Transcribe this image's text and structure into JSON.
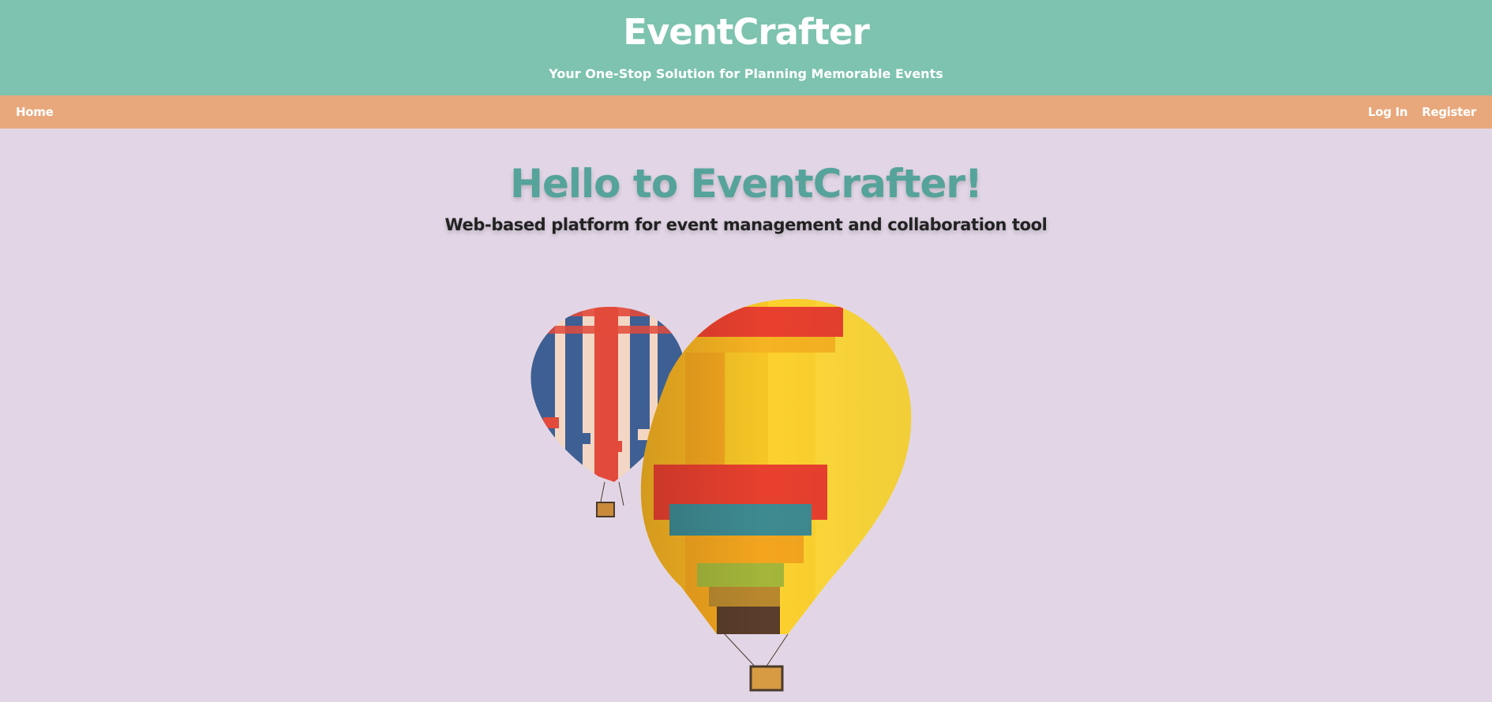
{
  "header": {
    "title": "EventCrafter",
    "tagline": "Your One-Stop Solution for Planning Memorable Events",
    "bg_color": "#7dc3af"
  },
  "nav": {
    "home_label": "Home",
    "login_label": "Log In",
    "register_label": "Register",
    "bg_color": "#e8a87c"
  },
  "hero": {
    "heading": "Hello to EventCrafter!",
    "subheading": "Web-based platform for event management and collaboration tool",
    "heading_color": "#55a39a",
    "image": "hot-air-balloons-illustration"
  },
  "page_bg_color": "#e2d6e6"
}
